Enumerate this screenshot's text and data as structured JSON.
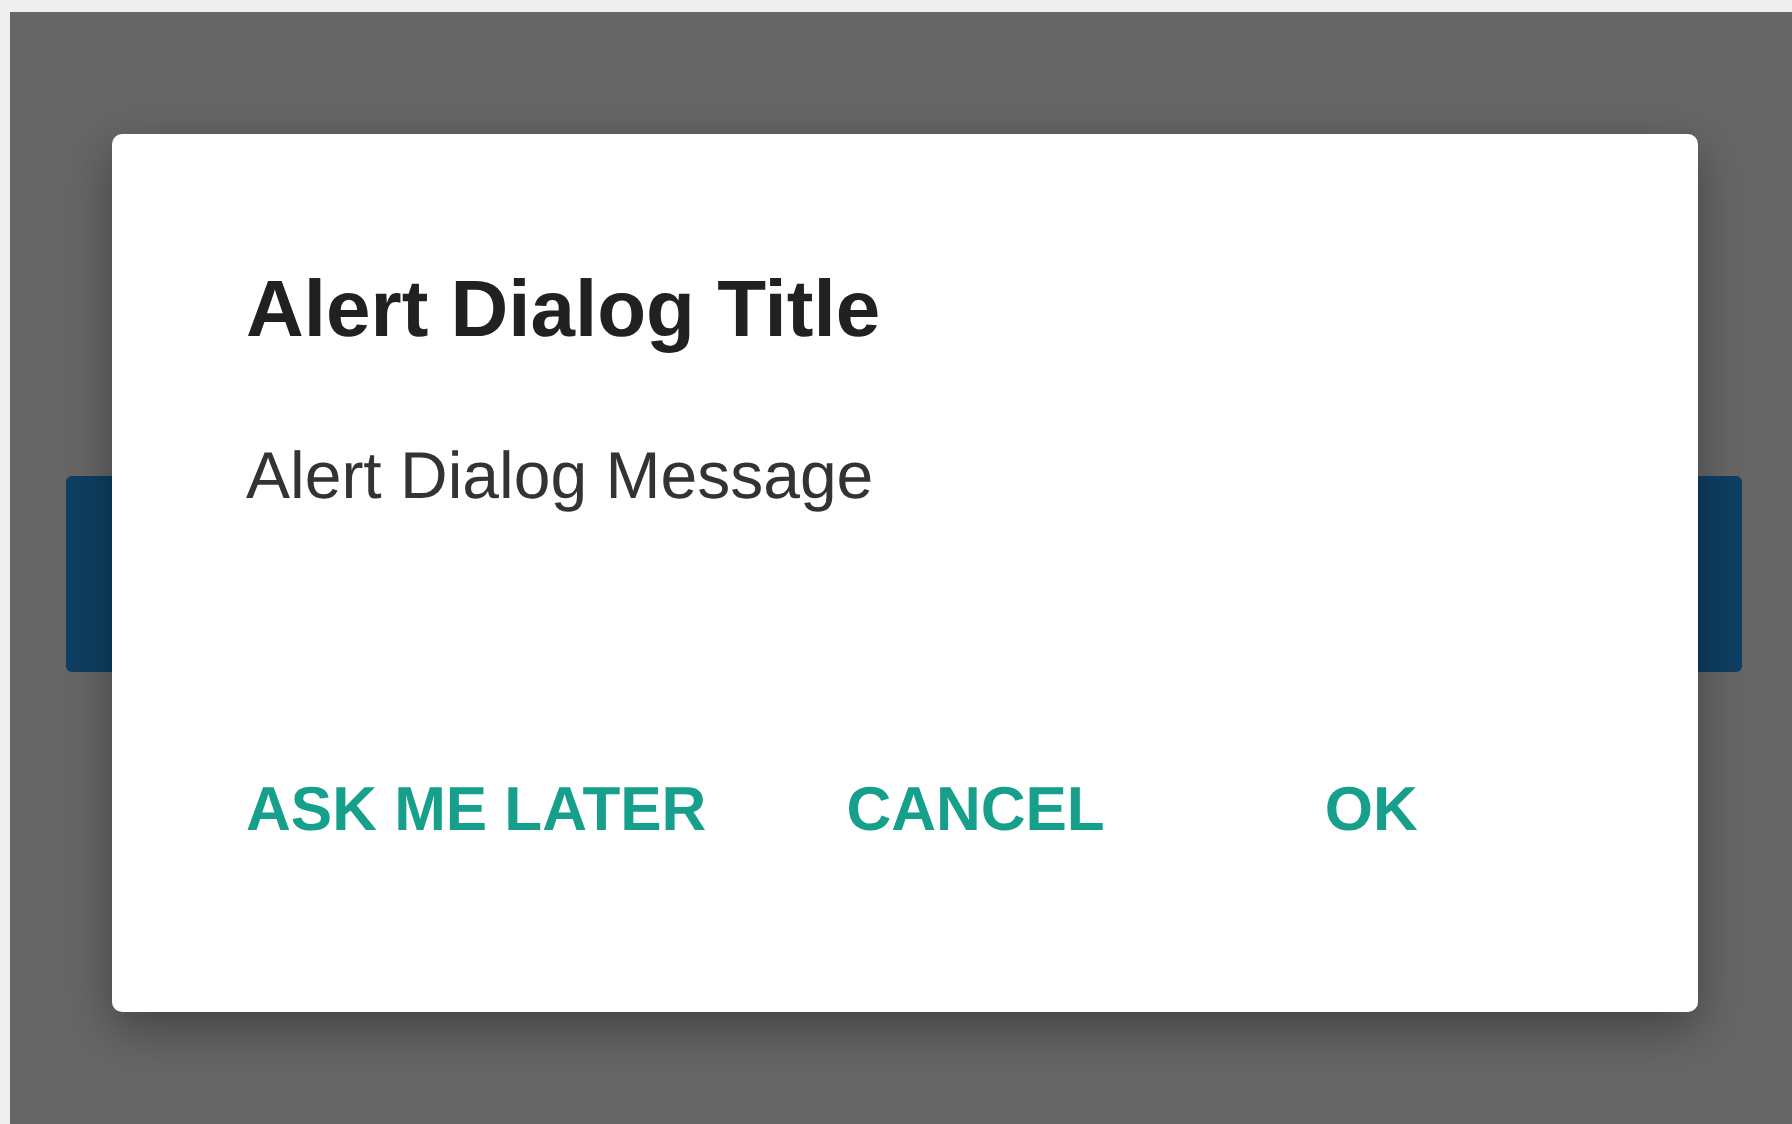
{
  "dialog": {
    "title": "Alert Dialog Title",
    "message": "Alert Dialog Message",
    "buttons": [
      "ASK ME LATER",
      "CANCEL",
      "OK"
    ]
  }
}
